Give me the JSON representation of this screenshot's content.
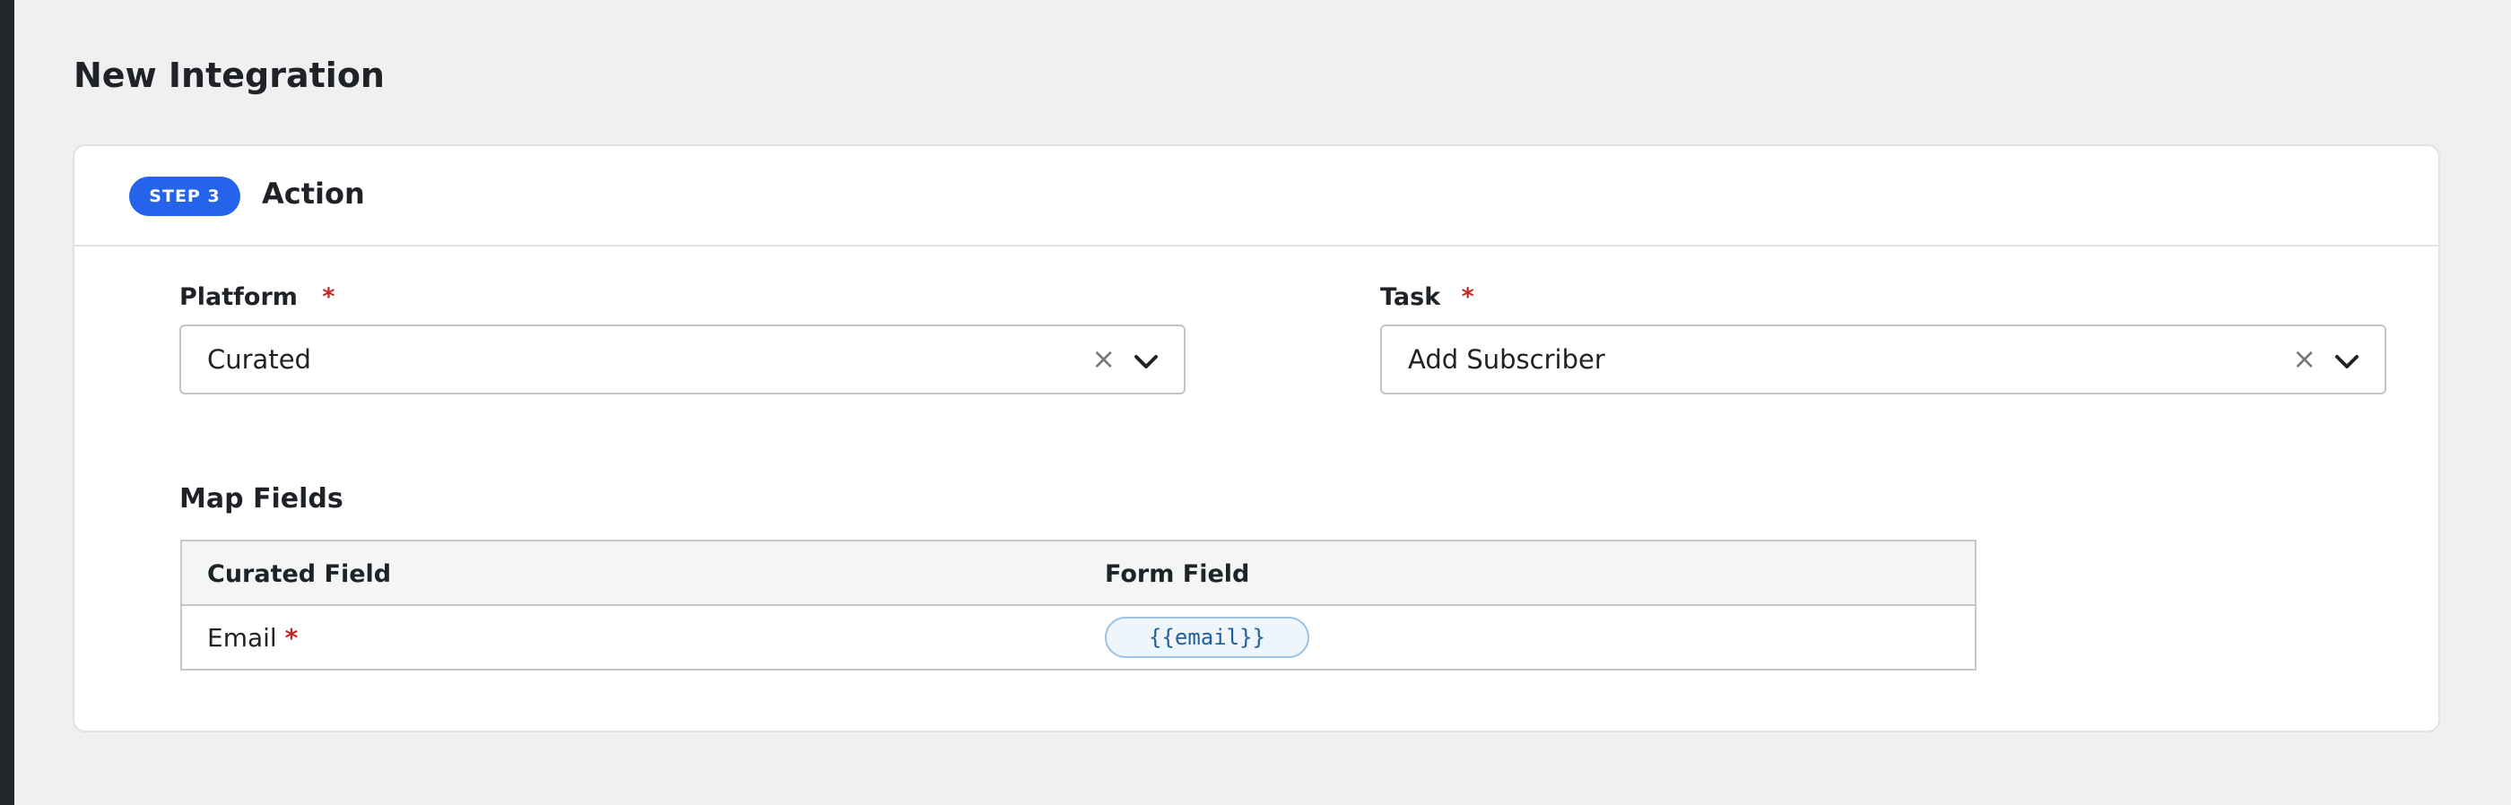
{
  "page": {
    "title": "New Integration"
  },
  "step": {
    "badge": "STEP 3",
    "title": "Action"
  },
  "platform": {
    "label": "Platform",
    "required_mark": "*",
    "value": "Curated"
  },
  "task": {
    "label": "Task",
    "required_mark": "*",
    "value": "Add Subscriber"
  },
  "map_fields": {
    "title": "Map Fields",
    "columns": [
      "Curated Field",
      "Form Field"
    ],
    "rows": [
      {
        "field": "Email",
        "required_mark": "*",
        "form_token": "{{email}}"
      }
    ]
  },
  "icons": {
    "clear": "close-icon",
    "dropdown": "chevron-down-icon"
  },
  "colors": {
    "accent": "#2563eb",
    "required": "#c62828",
    "token_bg": "#eef6fc"
  }
}
